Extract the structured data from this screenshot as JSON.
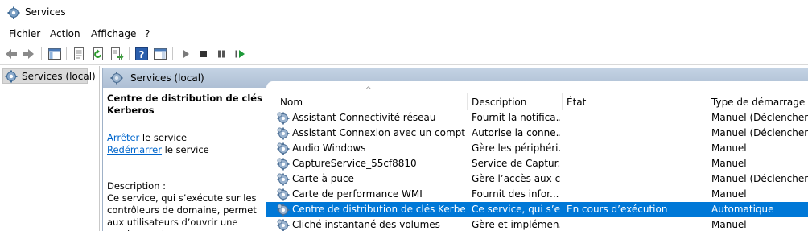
{
  "window": {
    "title": "Services"
  },
  "menu": [
    "Fichier",
    "Action",
    "Affichage",
    "?"
  ],
  "tree": {
    "root_label": "Services (local)"
  },
  "pane_header": {
    "label": "Services (local)"
  },
  "description_panel": {
    "service_name": "Centre de distribution de clés Kerberos",
    "stop_link": "Arrêter",
    "stop_suffix": " le service",
    "restart_link": "Redémarrer",
    "restart_suffix": " le service",
    "description_label": "Description :",
    "description_text": "Ce service, qui s’exécute sur les contrôleurs de domaine, permet aux utilisateurs d’ouvrir une session sur le"
  },
  "columns": [
    "Nom",
    "Description",
    "État",
    "Type de démarrage"
  ],
  "rows": [
    {
      "name": "Assistant Connectivité réseau",
      "description": "Fournit la notifica...",
      "state": "",
      "startup": "Manuel (Déclencher..."
    },
    {
      "name": "Assistant Connexion avec un compte ...",
      "description": "Autorise la conne...",
      "state": "",
      "startup": "Manuel (Déclencher..."
    },
    {
      "name": "Audio Windows",
      "description": "Gère les périphéri...",
      "state": "",
      "startup": "Manuel"
    },
    {
      "name": "CaptureService_55cf8810",
      "description": "Service de Captur...",
      "state": "",
      "startup": "Manuel"
    },
    {
      "name": "Carte à puce",
      "description": "Gère l’accès aux c...",
      "state": "",
      "startup": "Manuel (Déclencher..."
    },
    {
      "name": "Carte de performance WMI",
      "description": "Fournit des infor...",
      "state": "",
      "startup": "Manuel"
    },
    {
      "name": "Centre de distribution de clés Kerberos",
      "description": "Ce service, qui s’e...",
      "state": "En cours d’exécution",
      "startup": "Automatique",
      "selected": true
    },
    {
      "name": "Cliché instantané des volumes",
      "description": "Gère et implémen...",
      "state": "",
      "startup": "Manuel"
    }
  ],
  "toolbar_icons": [
    "back-icon",
    "forward-icon",
    "show-hide-tree-icon",
    "properties-icon",
    "refresh-icon",
    "export-list-icon",
    "help-icon",
    "show-hide-action-pane-icon",
    "start-service-icon",
    "stop-service-icon",
    "pause-service-icon",
    "resume-service-icon"
  ],
  "colors": {
    "selection": "#0078d7",
    "link": "#0066cc",
    "pane_header": "#b8c9dc"
  }
}
